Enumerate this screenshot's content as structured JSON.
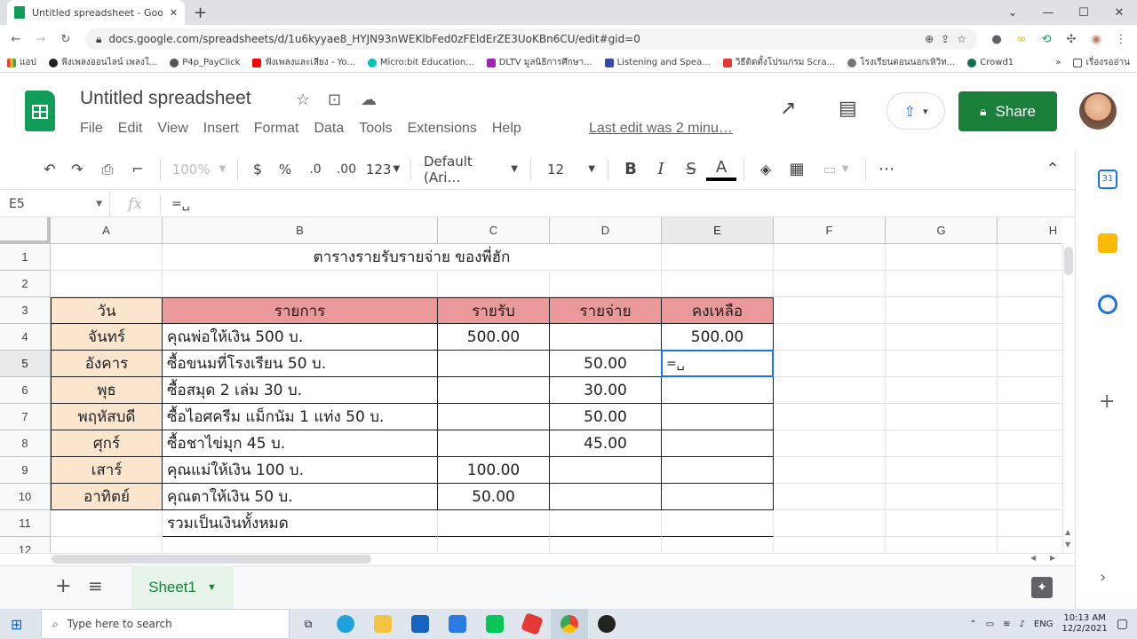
{
  "browser": {
    "tab_title": "Untitled spreadsheet - Google Sh",
    "new_tab_icon": "+",
    "url": "docs.google.com/spreadsheets/d/1u6kyyae8_HYJN93nWEKlbFed0zFEldErZE3UoKBn6CU/edit#gid=0",
    "bookmarks": [
      "แอป",
      "ฟังเพลงออนไลน์ เพลงใ...",
      "P4p_PayClick",
      "ฟังเพลงและเสียง - Yo...",
      "Micro:bit Education...",
      "DLTV มูลนิธิการศึกษา...",
      "Listening and Spea...",
      "วิธีติดตั้งโปรแกรม Scra...",
      "โรงเรียนตอนนอกเหิวิท...",
      "Crowd1"
    ],
    "bookmarks_more": "»",
    "reading_list": "เรื่องรออ่าน"
  },
  "app": {
    "doc_title": "Untitled spreadsheet",
    "menu": [
      "File",
      "Edit",
      "View",
      "Insert",
      "Format",
      "Data",
      "Tools",
      "Extensions",
      "Help"
    ],
    "last_edit": "Last edit was 2 minu…",
    "share_label": "Share",
    "accent": "#188038"
  },
  "format_toolbar": {
    "zoom": "100%",
    "currency": "$",
    "percent": "%",
    "dec_less": ".0",
    "dec_more": ".00",
    "more_formats": "123",
    "font": "Default (Ari…",
    "font_size": "12",
    "bold": "B",
    "italic": "I",
    "strike": "S",
    "text_color": "A"
  },
  "formula_bar": {
    "cell_ref": "E5",
    "fx": "fx",
    "value": "=␣"
  },
  "grid": {
    "columns": [
      "A",
      "B",
      "C",
      "D",
      "E",
      "F",
      "G",
      "H"
    ],
    "rows": [
      "1",
      "2",
      "3",
      "4",
      "5",
      "6",
      "7",
      "8",
      "9",
      "10",
      "11",
      "12"
    ],
    "title": "ตารางรายรับรายจ่าย ของพี่ฮัก",
    "headers": [
      "วัน",
      "รายการ",
      "รายรับ",
      "รายจ่าย",
      "คงเหลือ"
    ],
    "data": [
      [
        "จันทร์",
        "คุณพ่อให้เงิน 500 บ.",
        "500.00",
        "",
        "500.00"
      ],
      [
        "อังคาร",
        "ซื้อขนมที่โรงเรียน 50 บ.",
        "",
        "50.00",
        "=␣"
      ],
      [
        "พุธ",
        "ซื้อสมุด 2 เล่ม 30 บ.",
        "",
        "30.00",
        ""
      ],
      [
        "พฤหัสบดี",
        "ซื้อไอศครีม แม็กนัม 1 แท่ง 50 บ.",
        "",
        "50.00",
        ""
      ],
      [
        "ศุกร์",
        "ซื้อชาไข่มุก 45 บ.",
        "",
        "45.00",
        ""
      ],
      [
        "เสาร์",
        "คุณแม่ให้เงิน 100 บ.",
        "100.00",
        "",
        ""
      ],
      [
        "อาทิตย์",
        "คุณตาให้เงิน 50 บ.",
        "50.00",
        "",
        ""
      ]
    ],
    "total_label": "รวมเป็นเงินทั้งหมด",
    "day_fill": "#fce5cd",
    "header_fill": "#ea9999",
    "selection": "#1a73e8"
  },
  "sheets": {
    "tab": "Sheet1",
    "add": "+",
    "list": "≡"
  },
  "taskbar": {
    "search_placeholder": "Type here to search",
    "lang": "ENG",
    "time": "10:13 AM",
    "date": "12/2/2021"
  }
}
